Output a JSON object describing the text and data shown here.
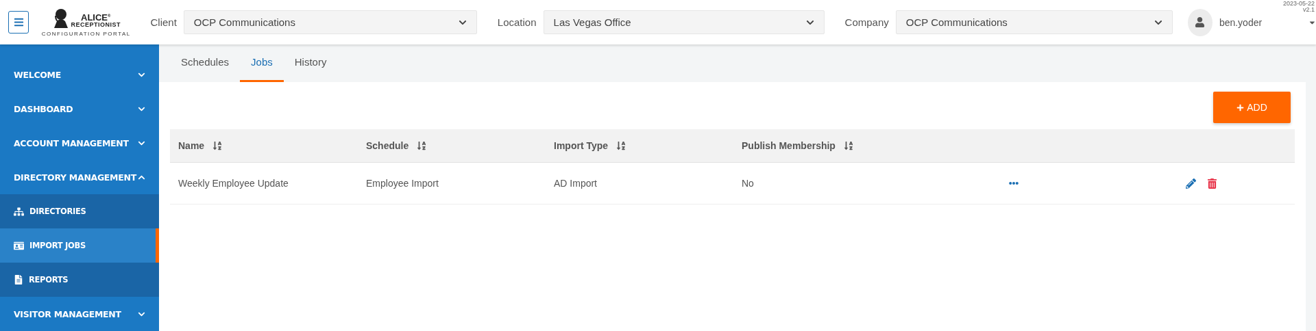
{
  "header": {
    "logo": {
      "brand": "ALICE$^{®}$",
      "sub": "RECEPTIONIST",
      "caption": "CONFIGURATION PORTAL"
    },
    "filters": [
      {
        "label": "Client",
        "value": "OCP Communications"
      },
      {
        "label": "Location",
        "value": "Las Vegas Office"
      },
      {
        "label": "Company",
        "value": "OCP Communications"
      }
    ],
    "user": {
      "name": "ben.yoder"
    },
    "version": {
      "date": "2023-05-22",
      "number": "v2.1"
    }
  },
  "sidebar": {
    "items": [
      {
        "kind": "section",
        "label": "WELCOME",
        "expanded": false
      },
      {
        "kind": "section",
        "label": "DASHBOARD",
        "expanded": false
      },
      {
        "kind": "section",
        "label": "ACCOUNT MANAGEMENT",
        "expanded": false
      },
      {
        "kind": "section",
        "label": "DIRECTORY MANAGEMENT",
        "expanded": true,
        "children": [
          {
            "kind": "sub",
            "label": "DIRECTORIES",
            "selected": false
          },
          {
            "kind": "sub",
            "label": "IMPORT JOBS",
            "selected": true
          },
          {
            "kind": "sub",
            "label": "REPORTS",
            "selected": false
          }
        ]
      },
      {
        "kind": "section",
        "label": "VISITOR MANAGEMENT",
        "expanded": false
      }
    ]
  },
  "tabs": [
    {
      "label": "Schedules",
      "selected": false
    },
    {
      "label": "Jobs",
      "selected": true
    },
    {
      "label": "History",
      "selected": false
    }
  ],
  "add_button": {
    "label": "ADD"
  },
  "table": {
    "columns": [
      "Name",
      "Schedule",
      "Import Type",
      "Publish Membership"
    ],
    "rows": [
      {
        "cells": [
          "Weekly Employee Update",
          "Employee Import",
          "AD Import",
          "No"
        ]
      }
    ]
  }
}
